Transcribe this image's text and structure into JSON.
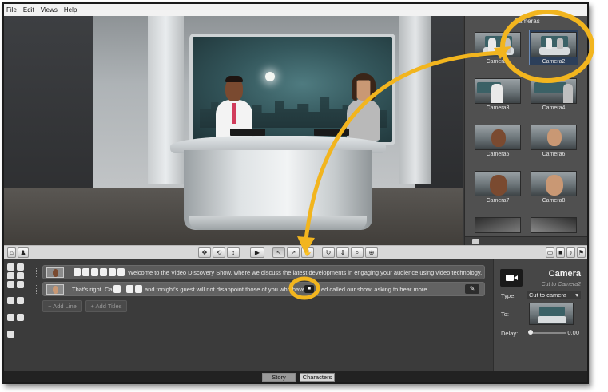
{
  "menubar": {
    "file": "File",
    "edit": "Edit",
    "views": "Views",
    "help": "Help"
  },
  "cameras": {
    "title": "Cameras",
    "items": [
      {
        "label": "Camera1"
      },
      {
        "label": "Camera2"
      },
      {
        "label": "Camera3"
      },
      {
        "label": "Camera4"
      },
      {
        "label": "Camera5"
      },
      {
        "label": "Camera6"
      },
      {
        "label": "Camera7"
      },
      {
        "label": "Camera8"
      }
    ],
    "selected": "Camera2"
  },
  "script": {
    "line1_text": "Welcome to the Video Discovery Show, where we discuss the latest developments in engaging your audience using video technology.",
    "line2_text_a": "That's right. Car",
    "line2_text_b": "and tonight's guest will not disappoint those of you who have",
    "line2_text_c": "ed called our show, asking to hear more.",
    "add_line": "+ Add Line",
    "add_titles": "+ Add Titles"
  },
  "properties": {
    "title": "Camera",
    "subtitle": "Cut to Camera2",
    "type_label": "Type:",
    "type_value": "Cut to camera",
    "to_label": "To:",
    "delay_label": "Delay:",
    "delay_value": "0.00"
  },
  "bottom_tabs": {
    "story": "Story",
    "characters": "Characters"
  },
  "colors": {
    "highlight": "#f2b51e",
    "panel": "#3b3b3b",
    "selected": "#2c3f5a"
  }
}
